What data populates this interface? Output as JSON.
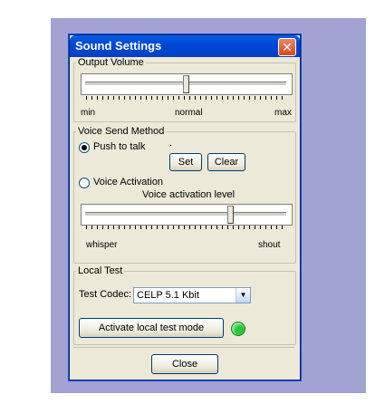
{
  "window": {
    "title": "Sound Settings"
  },
  "output_volume": {
    "legend": "Output Volume",
    "min_label": "min",
    "mid_label": "normal",
    "max_label": "max",
    "level": 0.5
  },
  "voice_send": {
    "legend": "Voice Send Method",
    "push_to_talk": {
      "label": "Push to talk",
      "selected": true,
      "hotkey": ".",
      "set_label": "Set",
      "clear_label": "Clear"
    },
    "voice_activation": {
      "label": "Voice Activation",
      "selected": false,
      "level_label": "Voice activation level",
      "low_label": "whisper",
      "high_label": "shout",
      "level": 0.72
    }
  },
  "local_test": {
    "legend": "Local Test",
    "codec_label": "Test Codec:",
    "codec_value": "CELP 5.1 Kbit",
    "activate_label": "Activate local test mode",
    "indicator_color": "#2bc63a"
  },
  "footer": {
    "close_label": "Close"
  }
}
